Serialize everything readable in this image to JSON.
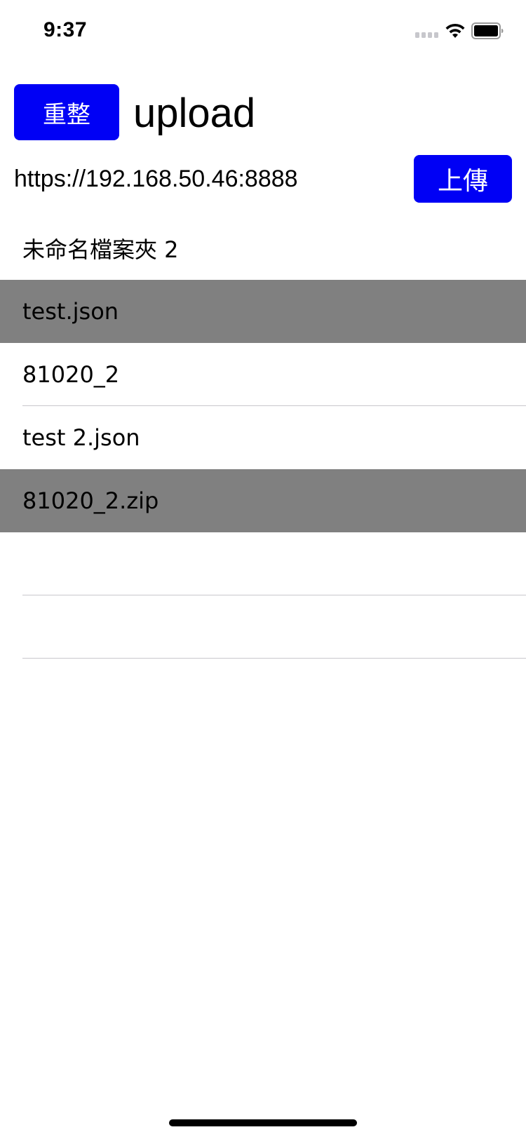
{
  "status_bar": {
    "time": "9:37"
  },
  "header": {
    "refresh_label": "重整",
    "title": "upload"
  },
  "server": {
    "url": "https://192.168.50.46:8888",
    "upload_label": "上傳"
  },
  "files": [
    {
      "name": "未命名檔案夾 2",
      "selected": false
    },
    {
      "name": "test.json",
      "selected": true
    },
    {
      "name": "81020_2",
      "selected": false
    },
    {
      "name": "test 2.json",
      "selected": false
    },
    {
      "name": "81020_2.zip",
      "selected": true
    },
    {
      "name": "",
      "selected": false
    },
    {
      "name": "",
      "selected": false
    }
  ],
  "icons": {
    "signal": "cellular-signal-icon",
    "wifi": "wifi-icon",
    "battery": "battery-icon"
  },
  "colors": {
    "button_blue": "#0000f5",
    "selected_row": "#808080",
    "separator": "#c8c7cc"
  }
}
